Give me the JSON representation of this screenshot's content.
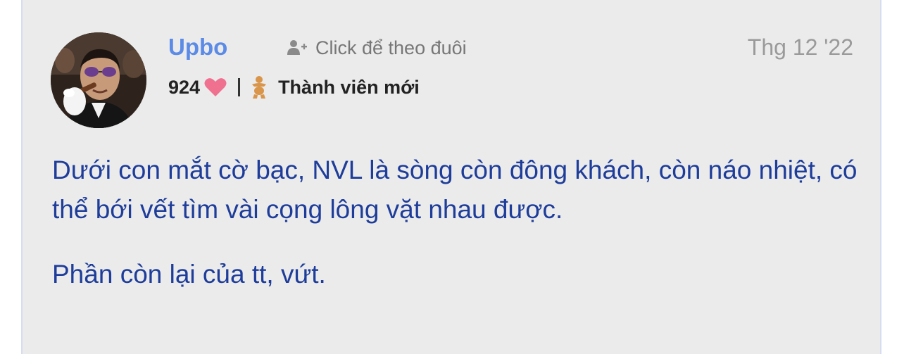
{
  "post": {
    "author": {
      "name": "Upbo",
      "avatar_icon": "user-avatar-photo",
      "reactions": "924",
      "reaction_icon": "heart-icon",
      "rank_icon": "baby-rank-icon",
      "rank": "Thành viên mới"
    },
    "follow": {
      "icon": "add-user-icon",
      "label": "Click để theo đuôi"
    },
    "timestamp": "Thg 12 '22",
    "body": {
      "paragraph1": "Dưới con mắt cờ bạc, NVL là sòng còn đông khách, còn náo nhiệt, có thể bới vết tìm vài cọng lông vặt nhau được.",
      "paragraph2": "Phần còn lại của tt, vứt."
    },
    "colors": {
      "username": "#5b8be6",
      "body_text": "#1e3d9a",
      "heart": "#f07090",
      "rank_icon": "#d9954a",
      "background": "#ebebeb"
    }
  }
}
